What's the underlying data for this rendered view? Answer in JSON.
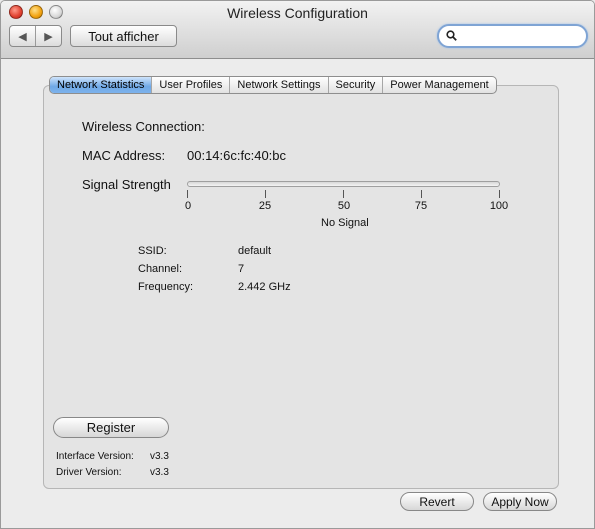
{
  "window": {
    "title": "Wireless Configuration"
  },
  "toolbar": {
    "back_icon": "triangle-left",
    "forward_icon": "triangle-right",
    "show_all_label": "Tout afficher",
    "search_icon": "magnifier",
    "search_value": ""
  },
  "tabs": [
    {
      "label": "Network Statistics",
      "active": true
    },
    {
      "label": "User Profiles",
      "active": false
    },
    {
      "label": "Network Settings",
      "active": false
    },
    {
      "label": "Security",
      "active": false
    },
    {
      "label": "Power Management",
      "active": false
    }
  ],
  "stats": {
    "wireless_connection_label": "Wireless Connection:",
    "mac_label": "MAC Address:",
    "mac_value": "00:14:6c:fc:40:bc",
    "signal_label": "Signal Strength",
    "signal_ticks": [
      "0",
      "25",
      "50",
      "75",
      "100"
    ],
    "signal_status": "No Signal",
    "ssid_label": "SSID:",
    "ssid_value": "default",
    "channel_label": "Channel:",
    "channel_value": "7",
    "frequency_label": "Frequency:",
    "frequency_value": "2.442 GHz"
  },
  "footer": {
    "register_label": "Register",
    "interface_version_label": "Interface Version:",
    "interface_version_value": "v3.3",
    "driver_version_label": "Driver Version:",
    "driver_version_value": "v3.3",
    "revert_label": "Revert",
    "apply_label": "Apply Now"
  },
  "colors": {
    "active_tab": "#6fa8e6",
    "search_focus_ring": "#7fa4d4"
  }
}
